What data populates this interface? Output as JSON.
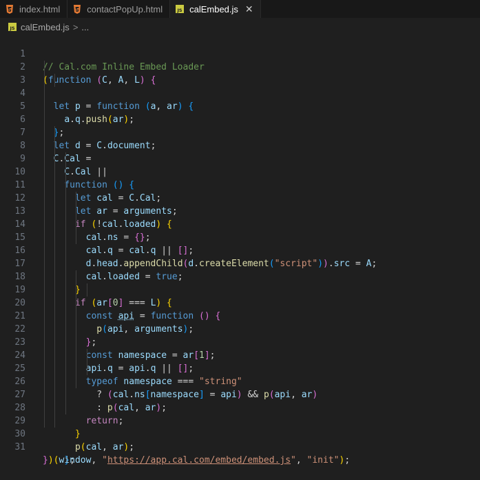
{
  "tabs": [
    {
      "label": "index.html",
      "icon": "html-file-icon",
      "active": false
    },
    {
      "label": "contactPopUp.html",
      "icon": "html-file-icon",
      "active": false
    },
    {
      "label": "calEmbed.js",
      "icon": "js-file-icon",
      "active": true,
      "close": "✕"
    }
  ],
  "breadcrumb": {
    "file": "calEmbed.js",
    "separator": ">",
    "rest": "..."
  },
  "colors": {
    "html_icon": "#e37933",
    "js_icon": "#cbcb41",
    "editor_bg": "#1f1f1f"
  },
  "line_numbers": [
    "1",
    "2",
    "3",
    "4",
    "5",
    "6",
    "7",
    "8",
    "9",
    "10",
    "11",
    "12",
    "13",
    "14",
    "15",
    "16",
    "17",
    "18",
    "19",
    "20",
    "21",
    "22",
    "23",
    "24",
    "25",
    "26",
    "27",
    "28",
    "29",
    "30",
    "31"
  ],
  "code": {
    "comment": "// Cal.com Inline Embed Loader",
    "url": "https://app.cal.com/embed/embed.js",
    "init": "\"init\""
  }
}
